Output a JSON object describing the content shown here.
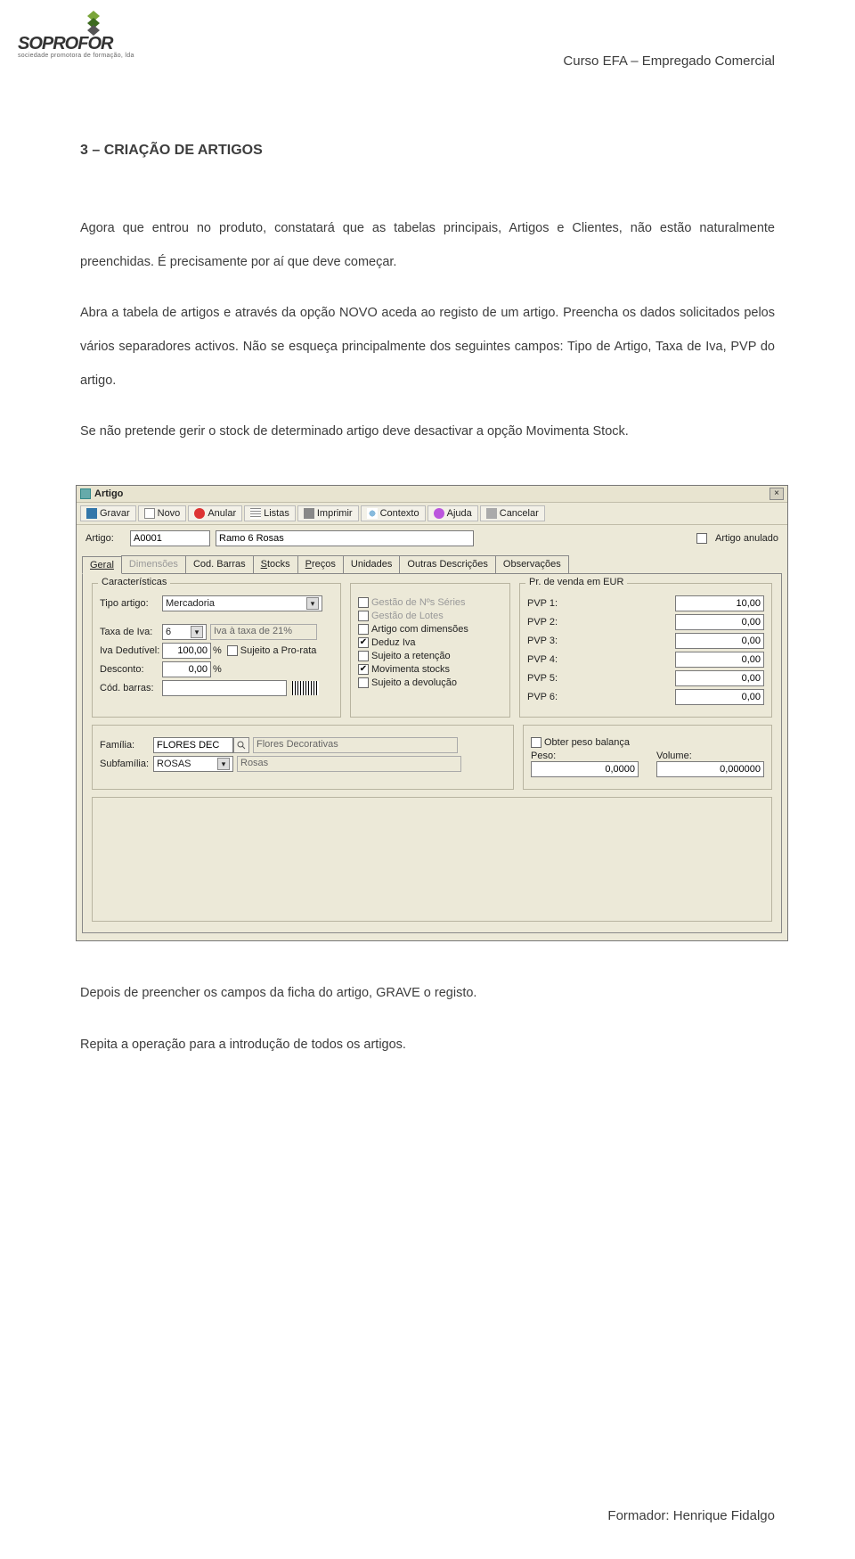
{
  "header": {
    "course": "Curso EFA – Empregado Comercial"
  },
  "logo": {
    "brand": "SOPROFOR",
    "tagline": "sociedade promotora\nde formação, lda"
  },
  "heading": "3 – CRIAÇÃO DE ARTIGOS",
  "para1": "Agora que entrou no produto, constatará que as tabelas principais, Artigos e Clientes, não estão naturalmente preenchidas. É precisamente por aí que deve começar.",
  "para2": "Abra a tabela de artigos e através da opção NOVO aceda ao registo de um artigo. Preencha os dados solicitados pelos vários separadores activos. Não se esqueça principalmente dos seguintes campos: Tipo de Artigo, Taxa de Iva, PVP do artigo.",
  "para3": "Se não pretende gerir o stock de determinado artigo deve desactivar a opção Movimenta Stock.",
  "para4": "Depois de preencher os campos da ficha do artigo, GRAVE o registo.",
  "para5": "Repita a operação para a introdução de todos os artigos.",
  "footer": "Formador: Henrique Fidalgo",
  "dialog": {
    "title": "Artigo",
    "toolbar": {
      "gravar": "Gravar",
      "novo": "Novo",
      "anular": "Anular",
      "listas": "Listas",
      "imprimir": "Imprimir",
      "contexto": "Contexto",
      "ajuda": "Ajuda",
      "cancelar": "Cancelar"
    },
    "artigo_label": "Artigo:",
    "artigo_code": "A0001",
    "artigo_desc": "Ramo 6 Rosas",
    "anulado_label": "Artigo anulado",
    "tabs": {
      "geral": "Geral",
      "dimensoes": "Dimensões",
      "codbarras": "Cod. Barras",
      "stocks": "Stocks",
      "precos": "Preços",
      "unidades": "Unidades",
      "outras": "Outras Descrições",
      "obs": "Observações"
    },
    "carac": {
      "legend": "Características",
      "tipo_label": "Tipo artigo:",
      "tipo_value": "Mercadoria",
      "taxa_label": "Taxa de Iva:",
      "taxa_value": "6",
      "taxa_note": "Iva à taxa de 21%",
      "ivaded_label": "Iva Dedutível:",
      "ivaded_value": "100,00",
      "ivaded_pct": "%",
      "prorata_label": "Sujeito a Pro-rata",
      "desconto_label": "Desconto:",
      "desconto_value": "0,00",
      "desconto_pct": "%",
      "codbarras_label": "Cód. barras:"
    },
    "mid": {
      "gns": "Gestão de Nºs Séries",
      "gl": "Gestão de Lotes",
      "acd": "Artigo com dimensões",
      "deduz": "Deduz Iva",
      "sret": "Sujeito a retenção",
      "mov": "Movimenta stocks",
      "sdev": "Sujeito a devolução"
    },
    "pv": {
      "legend": "Pr. de venda em EUR",
      "p1l": "PVP 1:",
      "p1v": "10,00",
      "p2l": "PVP 2:",
      "p2v": "0,00",
      "p3l": "PVP 3:",
      "p3v": "0,00",
      "p4l": "PVP 4:",
      "p4v": "0,00",
      "p5l": "PVP 5:",
      "p5v": "0,00",
      "p6l": "PVP 6:",
      "p6v": "0,00"
    },
    "fam": {
      "familia_label": "Família:",
      "familia_value": "FLORES DEC",
      "familia_desc": "Flores Decorativas",
      "subfam_label": "Subfamília:",
      "subfam_value": "ROSAS",
      "subfam_desc": "Rosas"
    },
    "bal": {
      "obter": "Obter peso balança",
      "peso_label": "Peso:",
      "peso_value": "0,0000",
      "vol_label": "Volume:",
      "vol_value": "0,000000"
    }
  }
}
